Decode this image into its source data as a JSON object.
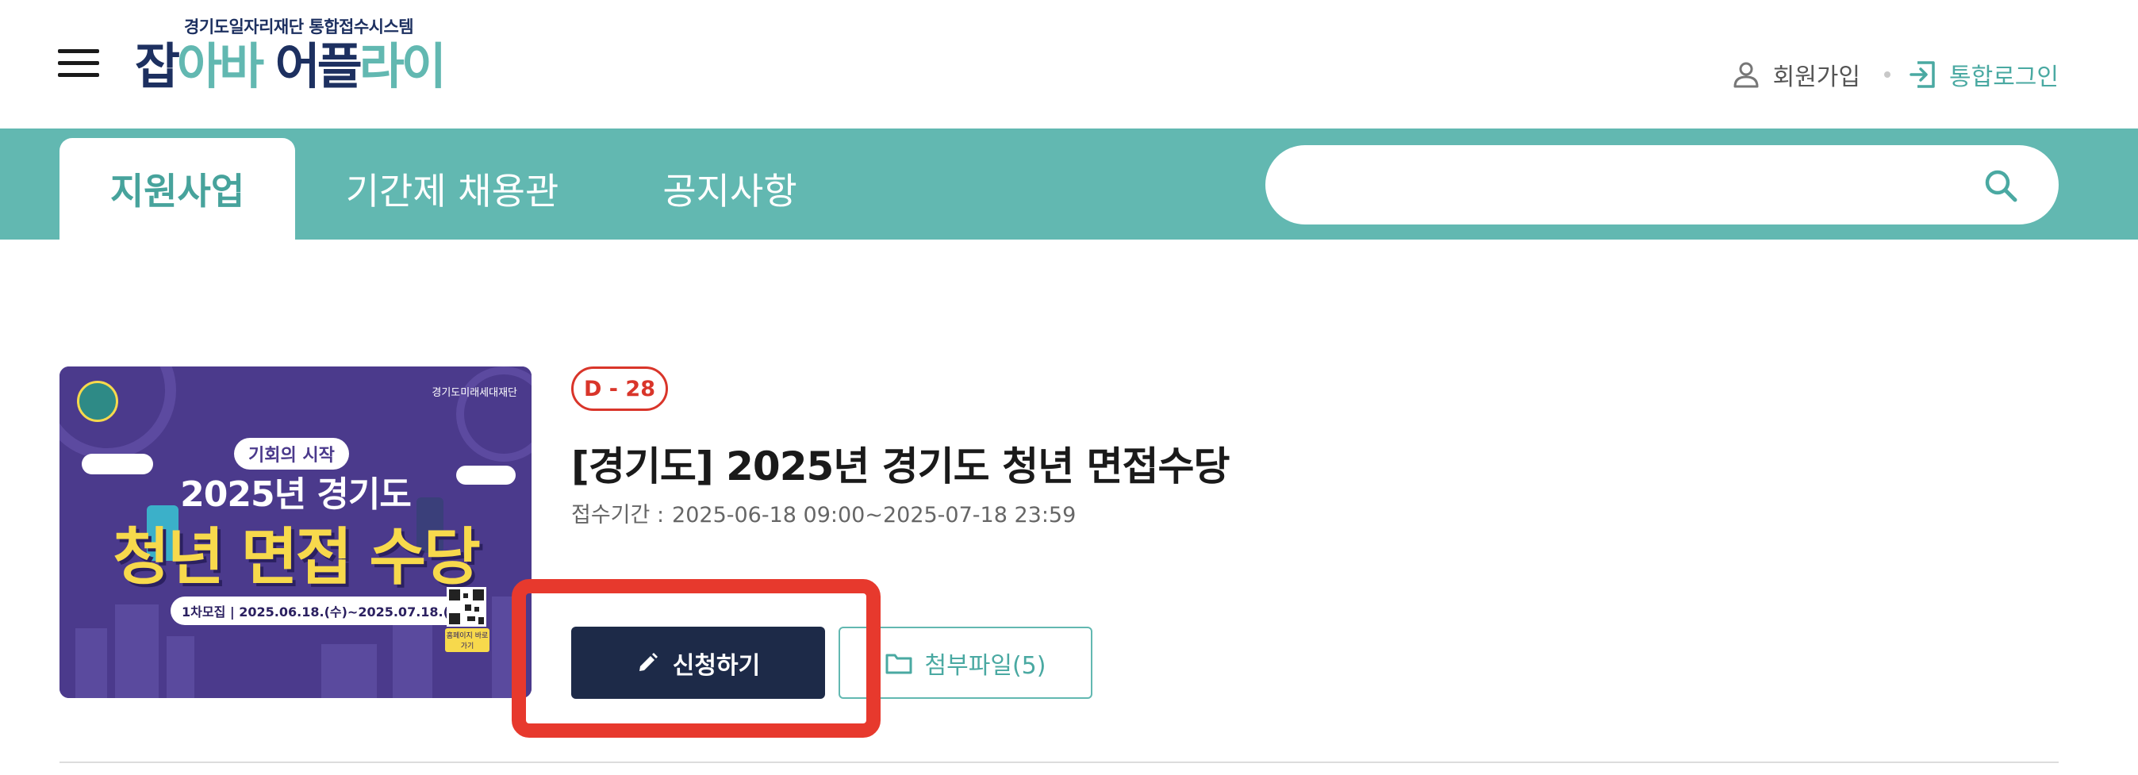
{
  "header": {
    "logo_sub": "경기도일자리재단 통합접수시스템",
    "logo_main_1": "잡",
    "logo_main_2": "아바",
    "logo_main_3": " 어플",
    "logo_main_4": "라이",
    "join_label": "회원가입",
    "login_label": "통합로그인"
  },
  "nav": {
    "tabs": [
      {
        "label": "지원사업",
        "active": true
      },
      {
        "label": "기간제 채용관",
        "active": false
      },
      {
        "label": "공지사항",
        "active": false
      }
    ],
    "search": {
      "value": "",
      "placeholder": ""
    }
  },
  "program": {
    "thumbnail": {
      "org": "경기도미래세대재단",
      "pill": "기회의 시작",
      "year_line": "2025년 경기도",
      "headline": "청년 면접 수당",
      "period": "1차모집 | 2025.06.18.(수)~2025.07.18.(금)",
      "qr_label": "홈페이지 바로가기"
    },
    "dday": "D - 28",
    "title": "[경기도] 2025년 경기도 청년 면접수당",
    "period_label": "접수기간 :",
    "period_value": "2025-06-18 09:00~2025-07-18 23:59",
    "apply_label": "신청하기",
    "attach_label": "첨부파일(5)"
  },
  "colors": {
    "teal": "#62b8b1",
    "navy": "#1d3060",
    "button_dark": "#1d2a48",
    "dday_red": "#d9352a",
    "highlight_red": "#e7392d"
  },
  "icons": [
    "menu-icon",
    "user-icon",
    "login-icon",
    "search-icon",
    "pencil-icon",
    "folder-icon"
  ]
}
